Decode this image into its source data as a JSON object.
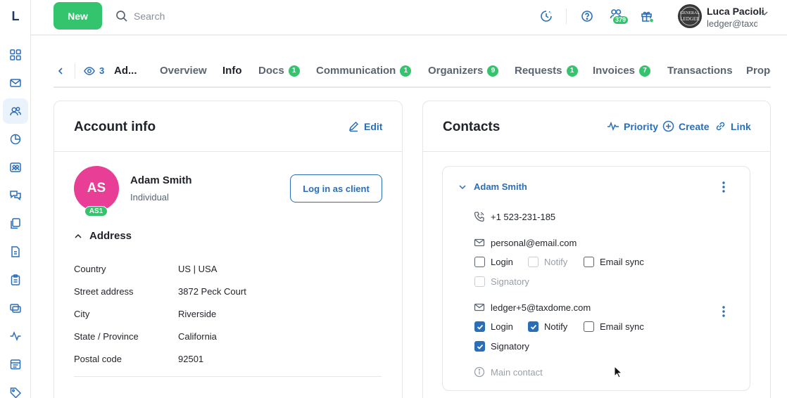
{
  "app": {
    "logo_letter": "L"
  },
  "topbar": {
    "new_label": "New",
    "search_placeholder": "Search",
    "notifications_badge": "379",
    "user": {
      "name": "Luca Pacioli",
      "email": "ledger@taxdome.com",
      "avatar_text": "GENERAL LEDGER"
    }
  },
  "sidebar": {
    "items": [
      {
        "icon": "dashboard-icon",
        "active": false
      },
      {
        "icon": "mail-icon",
        "active": false
      },
      {
        "icon": "clients-icon",
        "active": true
      },
      {
        "icon": "pie-chart-icon",
        "active": false
      },
      {
        "icon": "team-icon",
        "active": false
      },
      {
        "icon": "chat-icon",
        "active": false
      },
      {
        "icon": "documents-icon",
        "active": false
      },
      {
        "icon": "file-icon",
        "active": false
      },
      {
        "icon": "clipboard-icon",
        "active": false
      },
      {
        "icon": "cards-icon",
        "active": false
      },
      {
        "icon": "activity-icon",
        "active": false
      },
      {
        "icon": "calendar-list-icon",
        "active": false
      },
      {
        "icon": "tag-icon",
        "active": false
      }
    ]
  },
  "tabs": {
    "viewers_count": "3",
    "account_short": "Ad...",
    "items": [
      {
        "label": "Overview",
        "count": ""
      },
      {
        "label": "Info",
        "count": ""
      },
      {
        "label": "Docs",
        "count": "1"
      },
      {
        "label": "Communication",
        "count": "1"
      },
      {
        "label": "Organizers",
        "count": "9"
      },
      {
        "label": "Requests",
        "count": "1"
      },
      {
        "label": "Invoices",
        "count": "7"
      },
      {
        "label": "Transactions",
        "count": ""
      },
      {
        "label": "Prope",
        "count": ""
      }
    ]
  },
  "account": {
    "title": "Account info",
    "edit_label": "Edit",
    "initials": "AS",
    "tag": "AS1",
    "name": "Adam Smith",
    "type": "Individual",
    "login_button": "Log in as client",
    "address_title": "Address",
    "address": [
      {
        "label": "Country",
        "value": "US | USA"
      },
      {
        "label": "Street address",
        "value": "3872 Peck Court"
      },
      {
        "label": "City",
        "value": "Riverside"
      },
      {
        "label": "State / Province",
        "value": "California"
      },
      {
        "label": "Postal code",
        "value": "92501"
      }
    ]
  },
  "contacts": {
    "title": "Contacts",
    "actions": {
      "priority": "Priority",
      "create": "Create",
      "link": "Link"
    },
    "contact": {
      "name": "Adam Smith",
      "phone": "+1 523-231-185",
      "emails": [
        {
          "address": "personal@email.com",
          "options": [
            {
              "label": "Login",
              "checked": false,
              "disabled": false
            },
            {
              "label": "Notify",
              "checked": false,
              "disabled": true
            },
            {
              "label": "Email sync",
              "checked": false,
              "disabled": false
            },
            {
              "label": "Signatory",
              "checked": false,
              "disabled": true
            }
          ]
        },
        {
          "address": "ledger+5@taxdome.com",
          "options": [
            {
              "label": "Login",
              "checked": true,
              "disabled": false
            },
            {
              "label": "Notify",
              "checked": true,
              "disabled": false
            },
            {
              "label": "Email sync",
              "checked": false,
              "disabled": false
            },
            {
              "label": "Signatory",
              "checked": true,
              "disabled": false
            }
          ]
        }
      ],
      "main_contact_label": "Main contact"
    }
  },
  "colors": {
    "accent": "#2a6eb8",
    "green": "#34c46e",
    "avatar": "#e83e96"
  }
}
